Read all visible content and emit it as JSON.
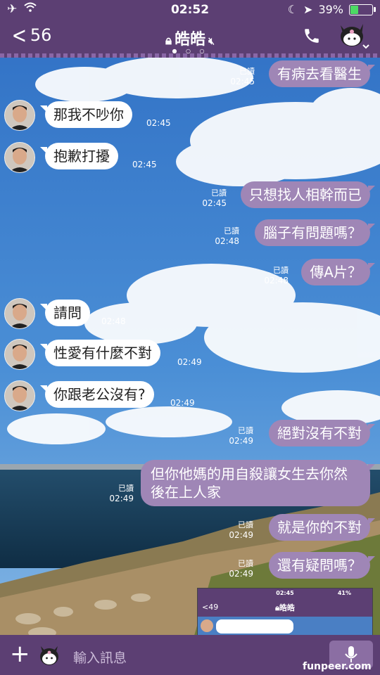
{
  "status_bar": {
    "time": "02:52",
    "battery": "39%"
  },
  "header": {
    "back_count": "56",
    "title": "皓皓"
  },
  "messages": [
    {
      "text": "有病去看醫生",
      "read": "已讀",
      "time": "02:45"
    },
    {
      "text": "那我不吵你",
      "time": "02:45"
    },
    {
      "text": "抱歉打擾",
      "time": "02:45"
    },
    {
      "text": "只想找人相幹而已",
      "read": "已讀",
      "time": "02:45"
    },
    {
      "text": "腦子有問題嗎？",
      "read": "已讀",
      "time": "02:48"
    },
    {
      "text": "傳A片？",
      "read": "已讀",
      "time": "02:48"
    },
    {
      "text": "請問",
      "time": "02:48"
    },
    {
      "text": "性愛有什麼不對",
      "time": "02:49"
    },
    {
      "text": "你跟老公沒有?",
      "time": "02:49"
    },
    {
      "text": "絕對沒有不對",
      "read": "已讀",
      "time": "02:49"
    },
    {
      "text": "但你他媽的用自殺讓女生去你然後在上人家",
      "read": "已讀",
      "time": "02:49"
    },
    {
      "text": "就是你的不對",
      "read": "已讀",
      "time": "02:49"
    },
    {
      "text": "還有疑問嗎？",
      "read": "已讀",
      "time": "02:49"
    }
  ],
  "thumbnail": {
    "time": "02:45",
    "battery": "41%",
    "back_count": "49",
    "title": "皓皓"
  },
  "input": {
    "placeholder": "輸入訊息"
  },
  "watermark": "funpeer.com"
}
